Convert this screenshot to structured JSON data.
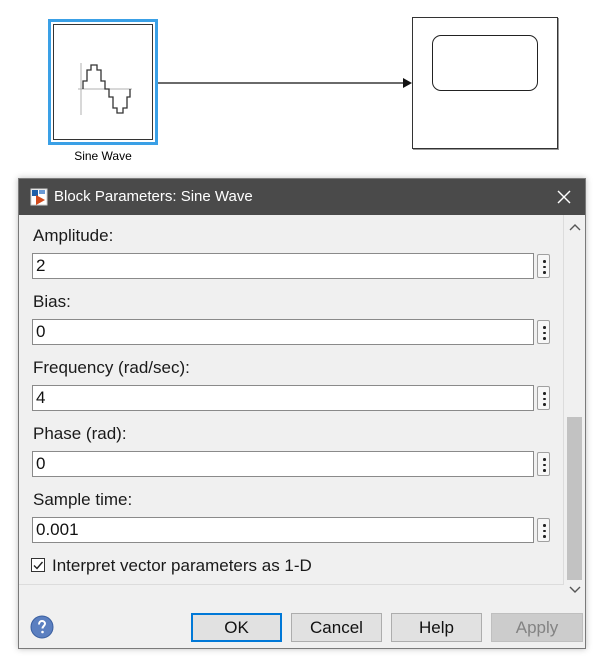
{
  "model": {
    "source_block_label": "Sine Wave"
  },
  "dialog": {
    "title": "Block Parameters: Sine Wave",
    "parameters": [
      {
        "label": "Amplitude:",
        "value": "2"
      },
      {
        "label": "Bias:",
        "value": "0"
      },
      {
        "label": "Frequency (rad/sec):",
        "value": "4"
      },
      {
        "label": "Phase (rad):",
        "value": "0"
      },
      {
        "label": "Sample time:",
        "value": "0.001"
      }
    ],
    "checkbox": {
      "label": "Interpret vector parameters as 1-D",
      "checked": true
    },
    "buttons": {
      "ok": "OK",
      "cancel": "Cancel",
      "help": "Help",
      "apply": "Apply"
    }
  },
  "colors": {
    "selection_border": "#3aa0e6",
    "titlebar": "#4a4a4a",
    "primary_button_border": "#0078d7",
    "help_icon": "#5b7fc0"
  },
  "icons": [
    "sine-wave-icon",
    "scope-icon",
    "simulink-block-icon",
    "close-icon",
    "chevron-up-icon",
    "chevron-down-icon",
    "help-icon",
    "more-options-icon",
    "checkmark-icon"
  ]
}
